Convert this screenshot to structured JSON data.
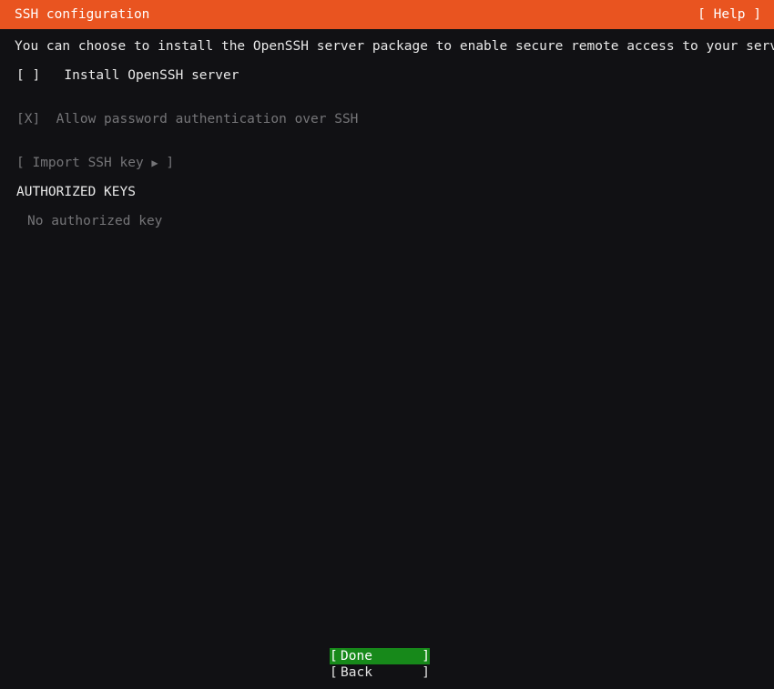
{
  "header": {
    "title": "SSH configuration",
    "help_label": "[ Help ]"
  },
  "colors": {
    "header_background": "#e95420",
    "screen_background": "#111114",
    "selected_button_background": "#17891a",
    "bright_text": "#e9e9e9",
    "dim_text": "#757578"
  },
  "main": {
    "intro_text": "You can choose to install the OpenSSH server package to enable secure remote access to your server.",
    "options": [
      {
        "checkbox": "[ ]",
        "label": "Install OpenSSH server",
        "state": "unchecked",
        "enabled": true
      },
      {
        "checkbox": "[X]",
        "label": "Allow password authentication over SSH",
        "state": "checked",
        "enabled": false
      }
    ],
    "import_key": {
      "open_bracket": "[",
      "label": "Import SSH key",
      "arrow": "▶",
      "close_bracket": "]",
      "enabled": false
    },
    "authorized_keys": {
      "heading": "AUTHORIZED KEYS",
      "empty_text": "No authorized key"
    }
  },
  "footer": {
    "buttons": [
      {
        "open_bracket": "[",
        "label": "Done",
        "close_bracket": "]",
        "selected": true
      },
      {
        "open_bracket": "[",
        "label": "Back",
        "close_bracket": "]",
        "selected": false
      }
    ]
  }
}
